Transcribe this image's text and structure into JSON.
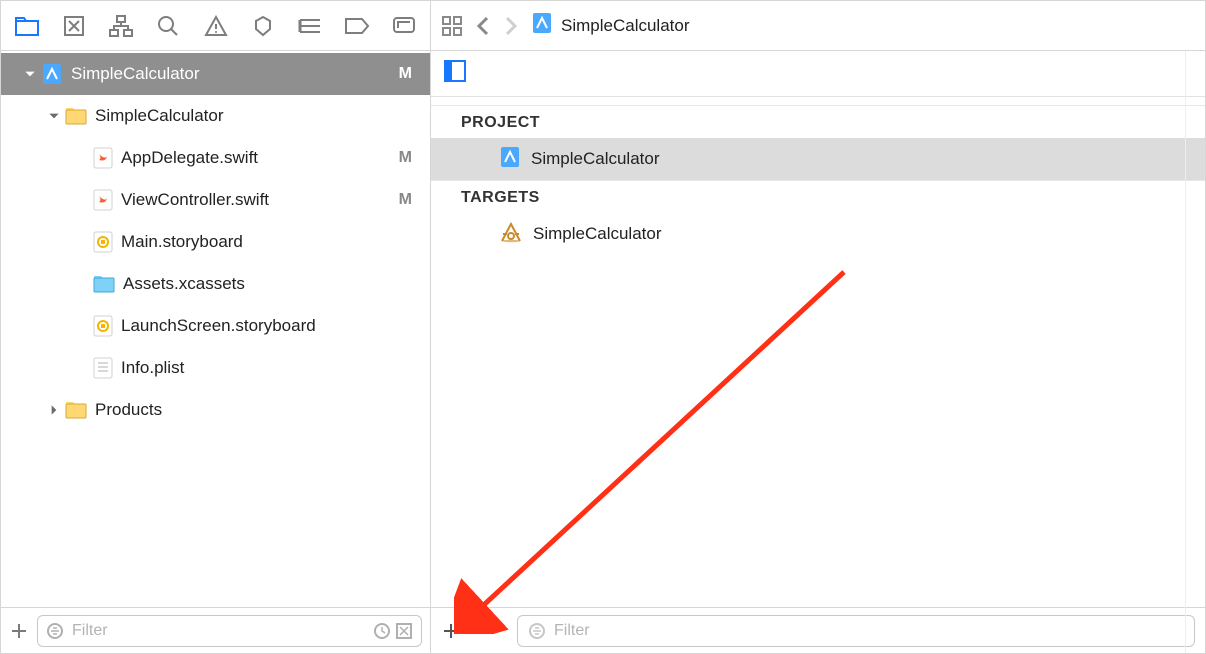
{
  "jumpbar": {
    "title": "SimpleCalculator"
  },
  "navigator": {
    "root": {
      "name": "SimpleCalculator",
      "status": "M"
    },
    "folder": {
      "name": "SimpleCalculator"
    },
    "files": [
      {
        "name": "AppDelegate.swift",
        "status": "M"
      },
      {
        "name": "ViewController.swift",
        "status": "M"
      },
      {
        "name": "Main.storyboard",
        "status": ""
      },
      {
        "name": "Assets.xcassets",
        "status": ""
      },
      {
        "name": "LaunchScreen.storyboard",
        "status": ""
      },
      {
        "name": "Info.plist",
        "status": ""
      }
    ],
    "products": {
      "name": "Products"
    },
    "filter_placeholder": "Filter"
  },
  "editor": {
    "project_header": "PROJECT",
    "project_item": "SimpleCalculator",
    "targets_header": "TARGETS",
    "target_item": "SimpleCalculator",
    "filter_placeholder": "Filter"
  }
}
